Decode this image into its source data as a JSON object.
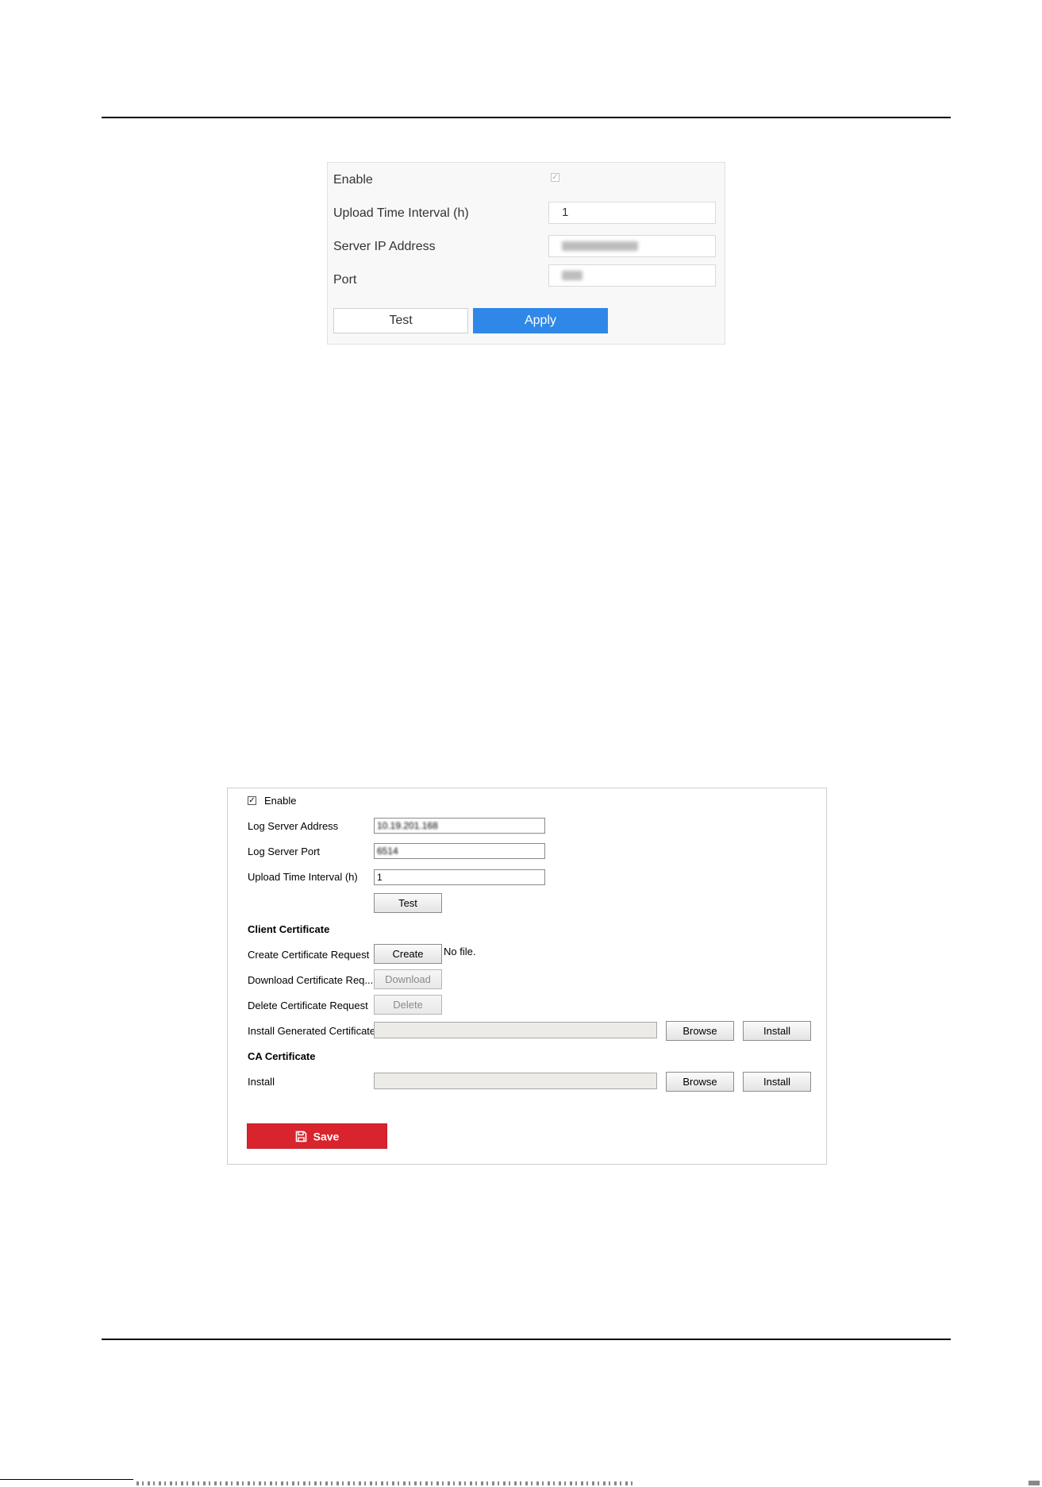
{
  "panel1": {
    "enable_label": "Enable",
    "upload_interval_label": "Upload Time Interval (h)",
    "upload_interval_value": "1",
    "server_ip_label": "Server IP Address",
    "port_label": "Port",
    "test_button": "Test",
    "apply_button": "Apply",
    "enable_checked": true,
    "accent_color": "#2f88e8"
  },
  "panel2": {
    "enable_label": "Enable",
    "enable_checked": true,
    "log_server_address_label": "Log Server Address",
    "log_server_address_value": "10.19.201.168",
    "log_server_port_label": "Log Server Port",
    "log_server_port_value": "6514",
    "upload_interval_label": "Upload Time Interval (h)",
    "upload_interval_value": "1",
    "test_button": "Test",
    "client_certificate_heading": "Client Certificate",
    "create_request_label": "Create Certificate Request",
    "create_button": "Create",
    "no_file_text": "No file.",
    "download_request_label": "Download Certificate Req...",
    "download_button": "Download",
    "delete_request_label": "Delete Certificate Request",
    "delete_button": "Delete",
    "install_generated_label": "Install Generated Certificate",
    "browse_button": "Browse",
    "install_button": "Install",
    "ca_certificate_heading": "CA Certificate",
    "install_label": "Install",
    "save_button": "Save",
    "save_color": "#d9232d"
  }
}
